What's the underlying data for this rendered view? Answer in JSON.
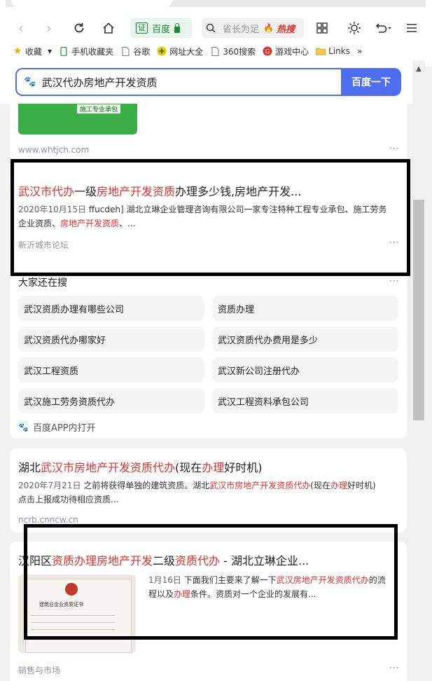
{
  "browser": {
    "address_cert": "证",
    "address_domain": "百度",
    "hot_search_query": "省长为足",
    "hot_search_label": "热搜",
    "bookmarks": [
      {
        "label": "收藏",
        "icon": "star-icon"
      },
      {
        "label": "手机收藏夹",
        "icon": "phone-icon"
      },
      {
        "label": "谷歌",
        "icon": "page-icon"
      },
      {
        "label": "网址大全",
        "icon": "plus-circle-icon"
      },
      {
        "label": "360搜索",
        "icon": "page-icon"
      },
      {
        "label": "游戏中心",
        "icon": "game-icon"
      },
      {
        "label": "Links",
        "icon": "folder-icon"
      }
    ],
    "bookmarks_more": "»"
  },
  "search": {
    "query": "武汉代办房地产开发资质",
    "button_label": "百度一下"
  },
  "results": {
    "top_site": "www.whtjch.com",
    "image_tag": "施工专业承包",
    "r1": {
      "title_parts": [
        "武汉市代办",
        "一级",
        "房地产开发资质",
        "办理多少钱,房地产开发..."
      ],
      "date": "2020年10月15日",
      "abstract_1": " ffucdeh] 湖北立琳企业管理咨询有限公司一家专注特种工程专业承包、施工劳务",
      "abstract_2a": "企业资质、",
      "abstract_2b": "房地产开发资质",
      "abstract_2c": "、...",
      "site": "新沂城市论坛"
    },
    "related": {
      "heading": "大家还在搜",
      "items": [
        "武汉资质办理有哪些公司",
        "资质办理",
        "武汉资质代办哪家好",
        "武汉资质代办费用是多少",
        "武汉工程资质",
        "武汉新公司注册代办",
        "武汉施工劳务资质代办",
        "武汉工程资料承包公司"
      ],
      "app_open": "百度APP内打开"
    },
    "r2": {
      "title_parts": [
        "湖北",
        "武汉市房地产开发资质代办",
        "(现在",
        "办理",
        "好时机)"
      ],
      "date": "2020年7月21日",
      "abstract_1a": " 之前将获得单独的建筑资质。湖北",
      "abstract_1b": "武汉市房地产开发资质代办",
      "abstract_1c": "(现在",
      "abstract_1d": "办理",
      "abstract_1e": "好时机)",
      "abstract_2": "点击上报成功待相应资质...",
      "site": "ncrb.cnncw.cn"
    },
    "r3": {
      "title_parts": [
        "汉阳区",
        "资质办理房地产开发",
        "二级",
        "资质代办",
        " - 湖北立琳企业..."
      ],
      "date": "1月16日",
      "abstract_1a": " 下面我们主要来了解一下",
      "abstract_1b": "武汉房地产开发资质代办",
      "abstract_1c": "的流",
      "abstract_2a": "程以及",
      "abstract_2b": "办理",
      "abstract_2c": "条件。资质对一个企业的发展有...",
      "cert_title": "建筑业企业资质证书",
      "site": "销售与市场"
    },
    "more_glyph": "···"
  }
}
